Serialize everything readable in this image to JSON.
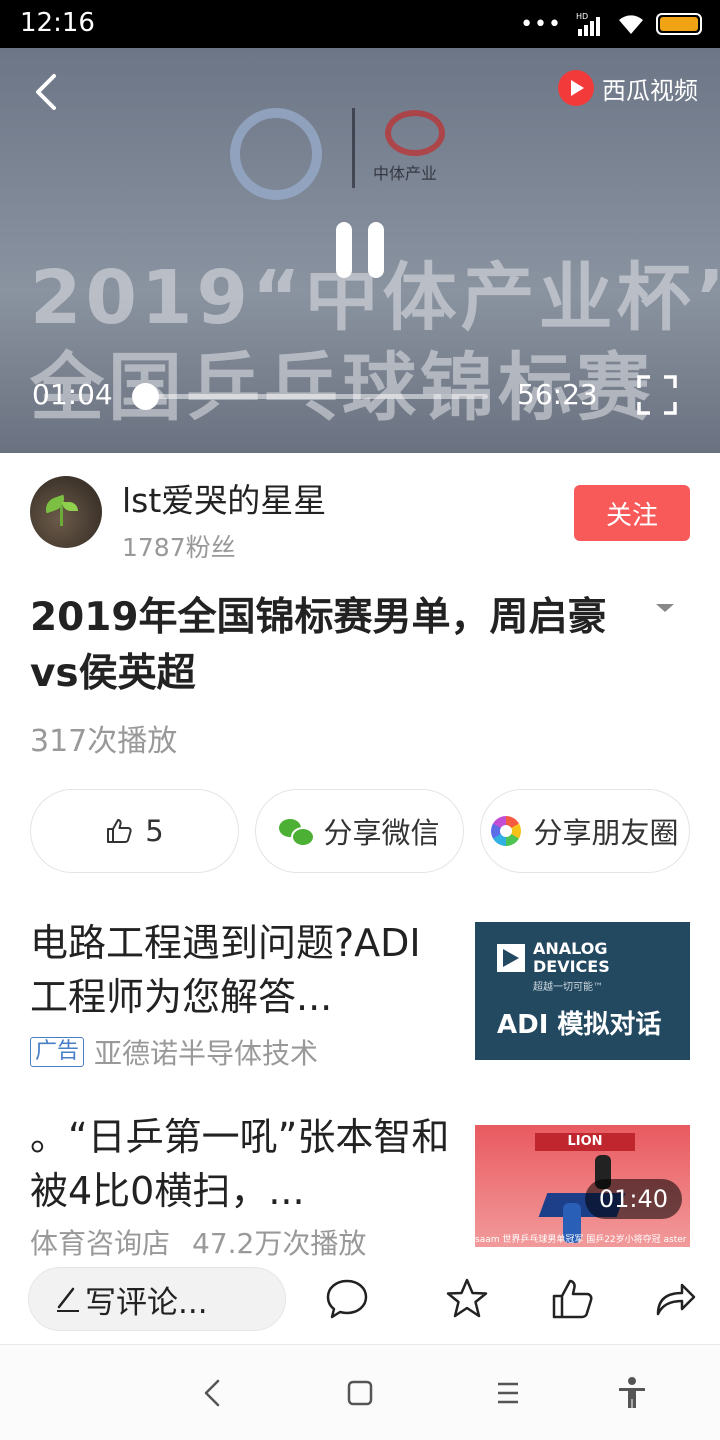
{
  "status_bar": {
    "time": "12:16",
    "signal": "•••",
    "network": "HD",
    "battery_color": "#f0a313"
  },
  "player": {
    "brand": "西瓜视频",
    "banner_line1": "2019“中体产业杯”",
    "banner_line2": "全国乒乓球锦标赛",
    "sponsor_text": "中体产业",
    "current_time": "01:04",
    "total_time": "56:23",
    "progress_fraction": 0.019
  },
  "author": {
    "name": "lst爱哭的星星",
    "fans": "1787粉丝",
    "follow_label": "关注"
  },
  "video": {
    "title": "2019年全国锦标赛男单，周启豪vs侯英超",
    "plays": "317次播放"
  },
  "actions": {
    "like_count": "5",
    "share_wechat": "分享微信",
    "share_moments": "分享朋友圈"
  },
  "feed": [
    {
      "title": "电路工程遇到问题?ADI工程师为您解答...",
      "badge": "广告",
      "source": "亚德诺半导体技术",
      "thumb": {
        "brand_line1": "ANALOG",
        "brand_line2": "DEVICES",
        "brand_sub": "超越一切可能™",
        "slogan": "ADI 模拟对话"
      }
    },
    {
      "title": "。“日乒第一吼”张本智和被4比0横扫，...",
      "source": "体育咨询店",
      "plays": "47.2万次播放",
      "thumb": {
        "banner": "LION",
        "caption": "saam 世界乒乓球男单冠军 国乒22岁小将夺冠 aster",
        "duration": "01:40"
      }
    }
  ],
  "comment_bar": {
    "placeholder": "写评论..."
  },
  "colors": {
    "accent": "#f85959",
    "progress": "#f04142",
    "link": "#4a7fc6"
  }
}
